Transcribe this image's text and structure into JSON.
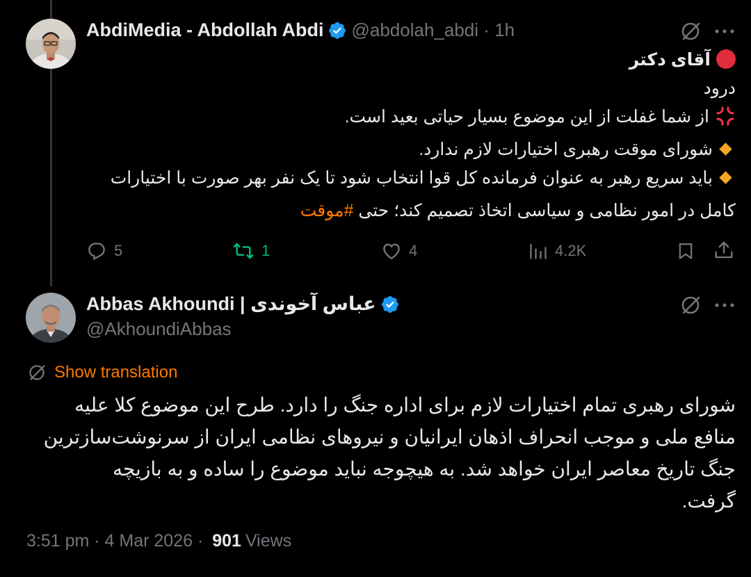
{
  "colors": {
    "accent": "#ff7a00",
    "verified": "#1d9bf0",
    "muted": "#71767b",
    "retweet": "#00ba7c"
  },
  "tweet1": {
    "display_name": "AbdiMedia - Abdollah Abdi",
    "handle": "@abdolah_abdi · 1h",
    "lines": [
      "آقای دکتر",
      "درود",
      "از شما غفلت از این موضوع بسیار حیاتی بعید است.",
      "شورای موقت رهبری اختیارات لازم ندارد.",
      "باید سریع رهبر به عنوان فرمانده کل قوا انتخاب شود تا یک نفر بهر صورت با اختیارات"
    ],
    "last_line_text": "کامل در امور نظامی و سیاسی اتخاذ تصمیم کند؛ حتی ",
    "hashtag": "#موقت",
    "actions": {
      "replies": "5",
      "reposts": "1",
      "likes": "4",
      "views": "4.2K"
    }
  },
  "tweet2": {
    "display_name": "Abbas Akhoundi | عباس آخوندی",
    "handle": "@AkhoundiAbbas",
    "show_translation": "Show translation",
    "lines": [
      "شورای رهبری تمام اختیارات لازم برای اداره جنگ را دارد. طرح این موضوع کلا علیه",
      "منافع ملی و موجب انحراف اذهان ایرانیان و نیروهای نظامی ایران از سرنوشت‌سازترین",
      "جنگ تاریخ معاصر ایران خواهد شد. به هیچوجه نباید موضوع را ساده و به بازیچه",
      "گرفت."
    ],
    "timestamp": "3:51 pm · 4 Mar 2026 · ",
    "views_count": "901",
    "views_label": "Views"
  },
  "icons": [
    "grok-icon",
    "more-icon",
    "reply-icon",
    "repost-icon",
    "like-icon",
    "views-icon",
    "bookmark-icon",
    "share-icon",
    "red-circle-icon",
    "anger-icon",
    "diamond-icon",
    "verified-icon"
  ]
}
